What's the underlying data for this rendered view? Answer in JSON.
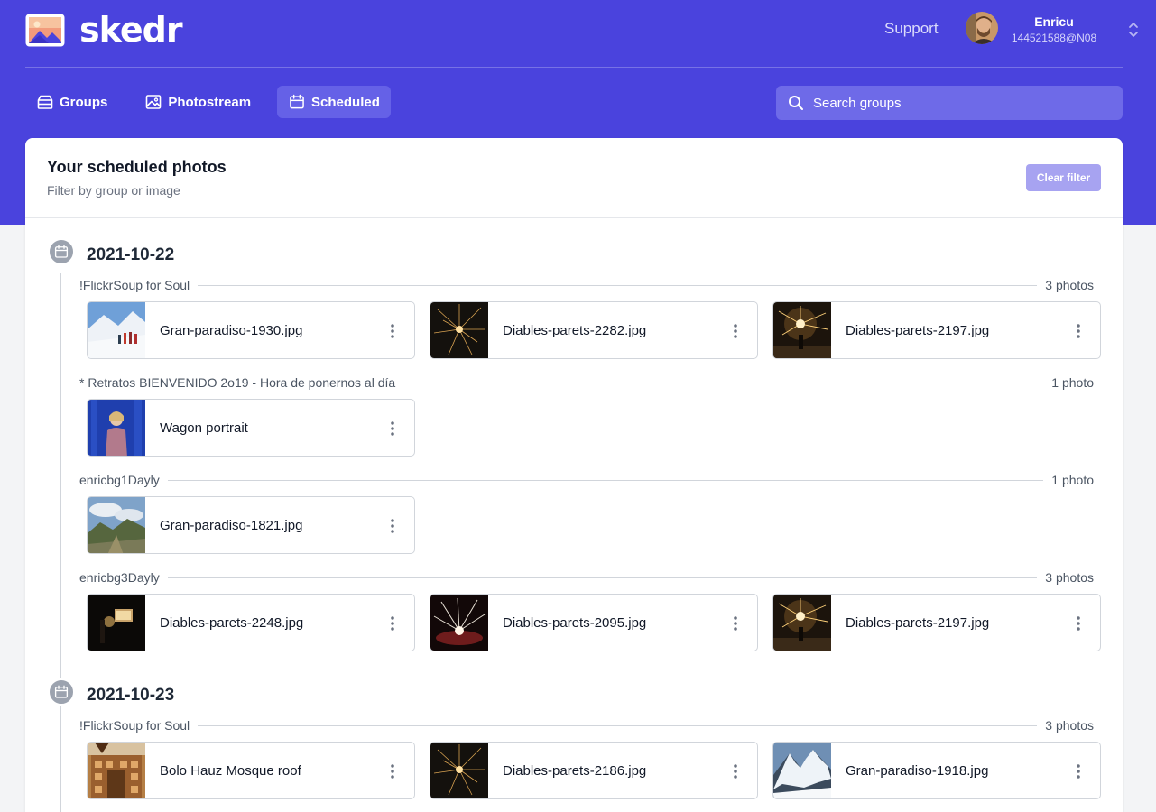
{
  "app": {
    "name": "skedr"
  },
  "header": {
    "support_label": "Support",
    "user": {
      "name": "Enricu",
      "id": "144521588@N08"
    }
  },
  "nav": {
    "items": [
      {
        "label": "Groups",
        "icon": "inbox-stack-icon",
        "active": false
      },
      {
        "label": "Photostream",
        "icon": "photo-icon",
        "active": false
      },
      {
        "label": "Scheduled",
        "icon": "calendar-icon",
        "active": true
      }
    ]
  },
  "search": {
    "placeholder": "Search groups",
    "value": ""
  },
  "page": {
    "title": "Your scheduled photos",
    "subtitle": "Filter by group or image",
    "clear_filter_label": "Clear filter"
  },
  "days": [
    {
      "date": "2021-10-22",
      "groups": [
        {
          "name": "!FlickrSoup for Soul",
          "count": "3 photos",
          "photos": [
            {
              "name": "Gran-paradiso-1930.jpg",
              "thumb": "snow-hikers"
            },
            {
              "name": "Diables-parets-2282.jpg",
              "thumb": "fireworks"
            },
            {
              "name": "Diables-parets-2197.jpg",
              "thumb": "fireworks-warm"
            }
          ]
        },
        {
          "name": "* Retratos BIENVENIDO 2o19 - Hora de ponernos al día",
          "count": "1 photo",
          "photos": [
            {
              "name": "Wagon portrait",
              "thumb": "portrait-blue"
            }
          ]
        },
        {
          "name": "enricbg1Dayly",
          "count": "1 photo",
          "photos": [
            {
              "name": "Gran-paradiso-1821.jpg",
              "thumb": "mountain-sky"
            }
          ]
        },
        {
          "name": "enricbg3Dayly",
          "count": "3 photos",
          "photos": [
            {
              "name": "Diables-parets-2248.jpg",
              "thumb": "dark-fire"
            },
            {
              "name": "Diables-parets-2095.jpg",
              "thumb": "red-sparks"
            },
            {
              "name": "Diables-parets-2197.jpg",
              "thumb": "fireworks-warm"
            }
          ]
        }
      ]
    },
    {
      "date": "2021-10-23",
      "groups": [
        {
          "name": "!FlickrSoup for Soul",
          "count": "3 photos",
          "photos": [
            {
              "name": "Bolo Hauz Mosque roof",
              "thumb": "mosque"
            },
            {
              "name": "Diables-parets-2186.jpg",
              "thumb": "fireworks"
            },
            {
              "name": "Gran-paradiso-1918.jpg",
              "thumb": "snow-peak"
            }
          ]
        }
      ]
    }
  ]
}
